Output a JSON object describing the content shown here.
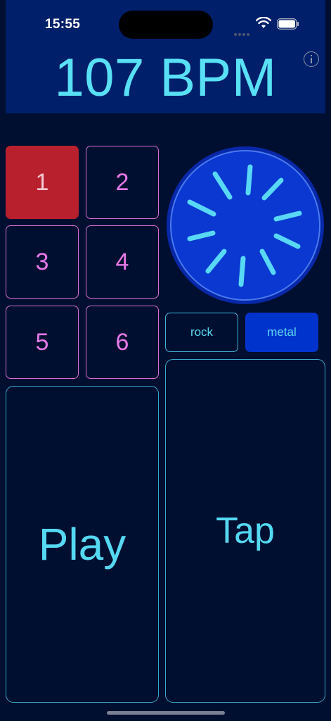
{
  "status": {
    "time": "15:55"
  },
  "header": {
    "bpm_text": "107 BPM"
  },
  "pads": [
    {
      "label": "1",
      "active": true
    },
    {
      "label": "2",
      "active": false
    },
    {
      "label": "3",
      "active": false
    },
    {
      "label": "4",
      "active": false
    },
    {
      "label": "5",
      "active": false
    },
    {
      "label": "6",
      "active": false
    }
  ],
  "styles": {
    "rock_label": "rock",
    "metal_label": "metal",
    "selected": "metal"
  },
  "controls": {
    "play_label": "Play",
    "tap_label": "Tap"
  },
  "colors": {
    "background": "#000f30",
    "header": "#001f6a",
    "accent_cyan": "#58e0f5",
    "pad_border": "#d66fd8",
    "pad_active": "#b8202e",
    "dial_fill": "#0a38d0",
    "selected_style": "#0033cc"
  },
  "icons": {
    "info": "info-icon",
    "wifi": "wifi-icon",
    "battery": "battery-icon",
    "signal": "cellular-signal-icon"
  }
}
